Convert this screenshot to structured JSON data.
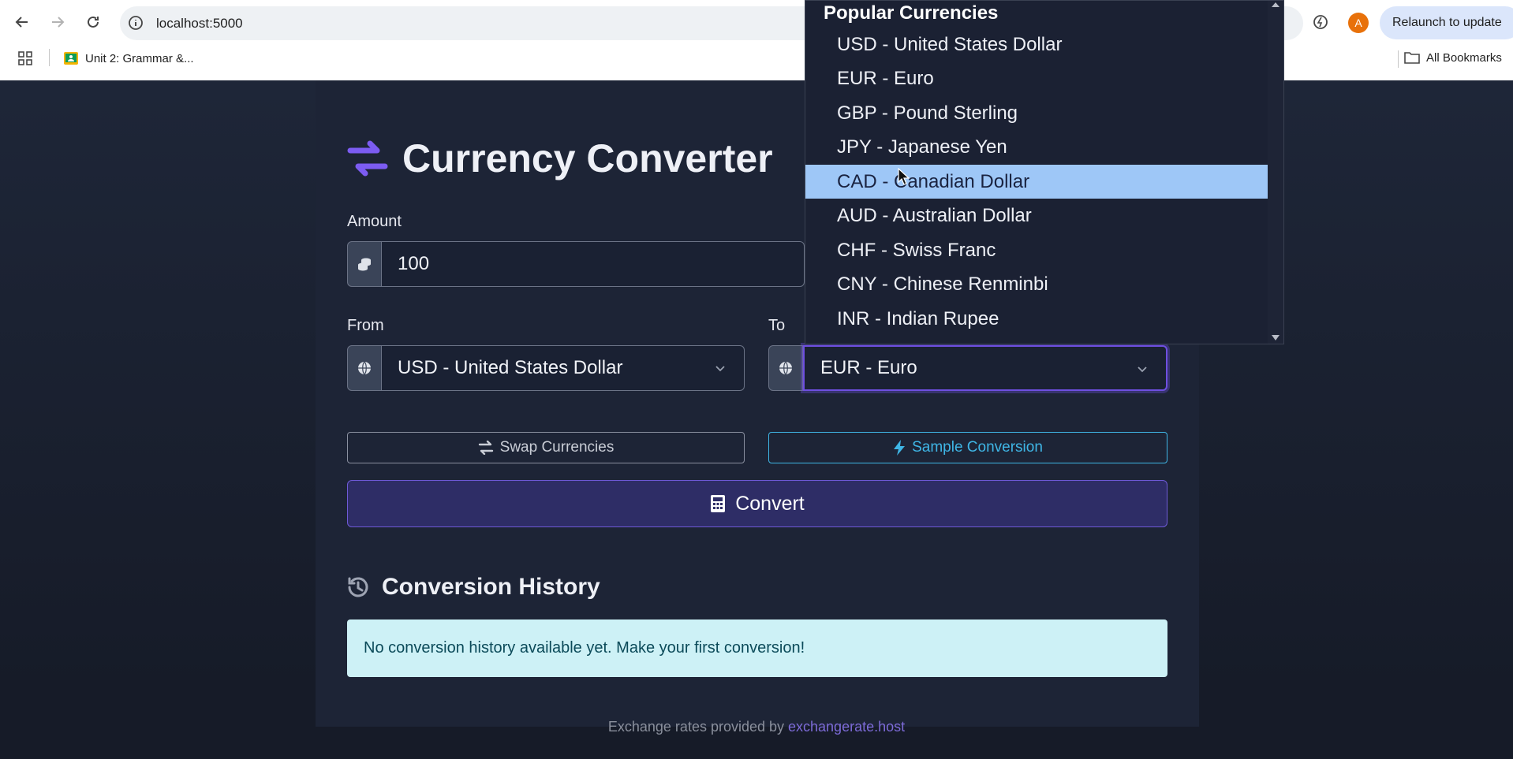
{
  "browser": {
    "url": "localhost:5000",
    "bookmark": "Unit 2: Grammar &...",
    "all_bookmarks": "All Bookmarks",
    "relaunch": "Relaunch to update",
    "avatar_letter": "A"
  },
  "app": {
    "title": "Currency Converter",
    "amount_label": "Amount",
    "amount_value": "100",
    "from_label": "From",
    "from_value": "USD - United States Dollar",
    "to_label": "To",
    "to_value": "EUR - Euro",
    "swap_label": "Swap Currencies",
    "sample_label": "Sample Conversion",
    "convert_label": "Convert",
    "history_title": "Conversion History",
    "history_empty": "No conversion history available yet. Make your first conversion!",
    "footer_text": "Exchange rates provided by ",
    "footer_link": "exchangerate.host"
  },
  "dropdown": {
    "group": "Popular Currencies",
    "items": [
      "USD - United States Dollar",
      "EUR - Euro",
      "GBP - Pound Sterling",
      "JPY - Japanese Yen",
      "CAD - Canadian Dollar",
      "AUD - Australian Dollar",
      "CHF - Swiss Franc",
      "CNY - Chinese Renminbi",
      "INR - Indian Rupee"
    ],
    "highlighted": "CAD - Canadian Dollar"
  },
  "colors": {
    "accent": "#6e4fe0",
    "sample": "#3fb6e6",
    "highlight": "#9ec7f7"
  }
}
